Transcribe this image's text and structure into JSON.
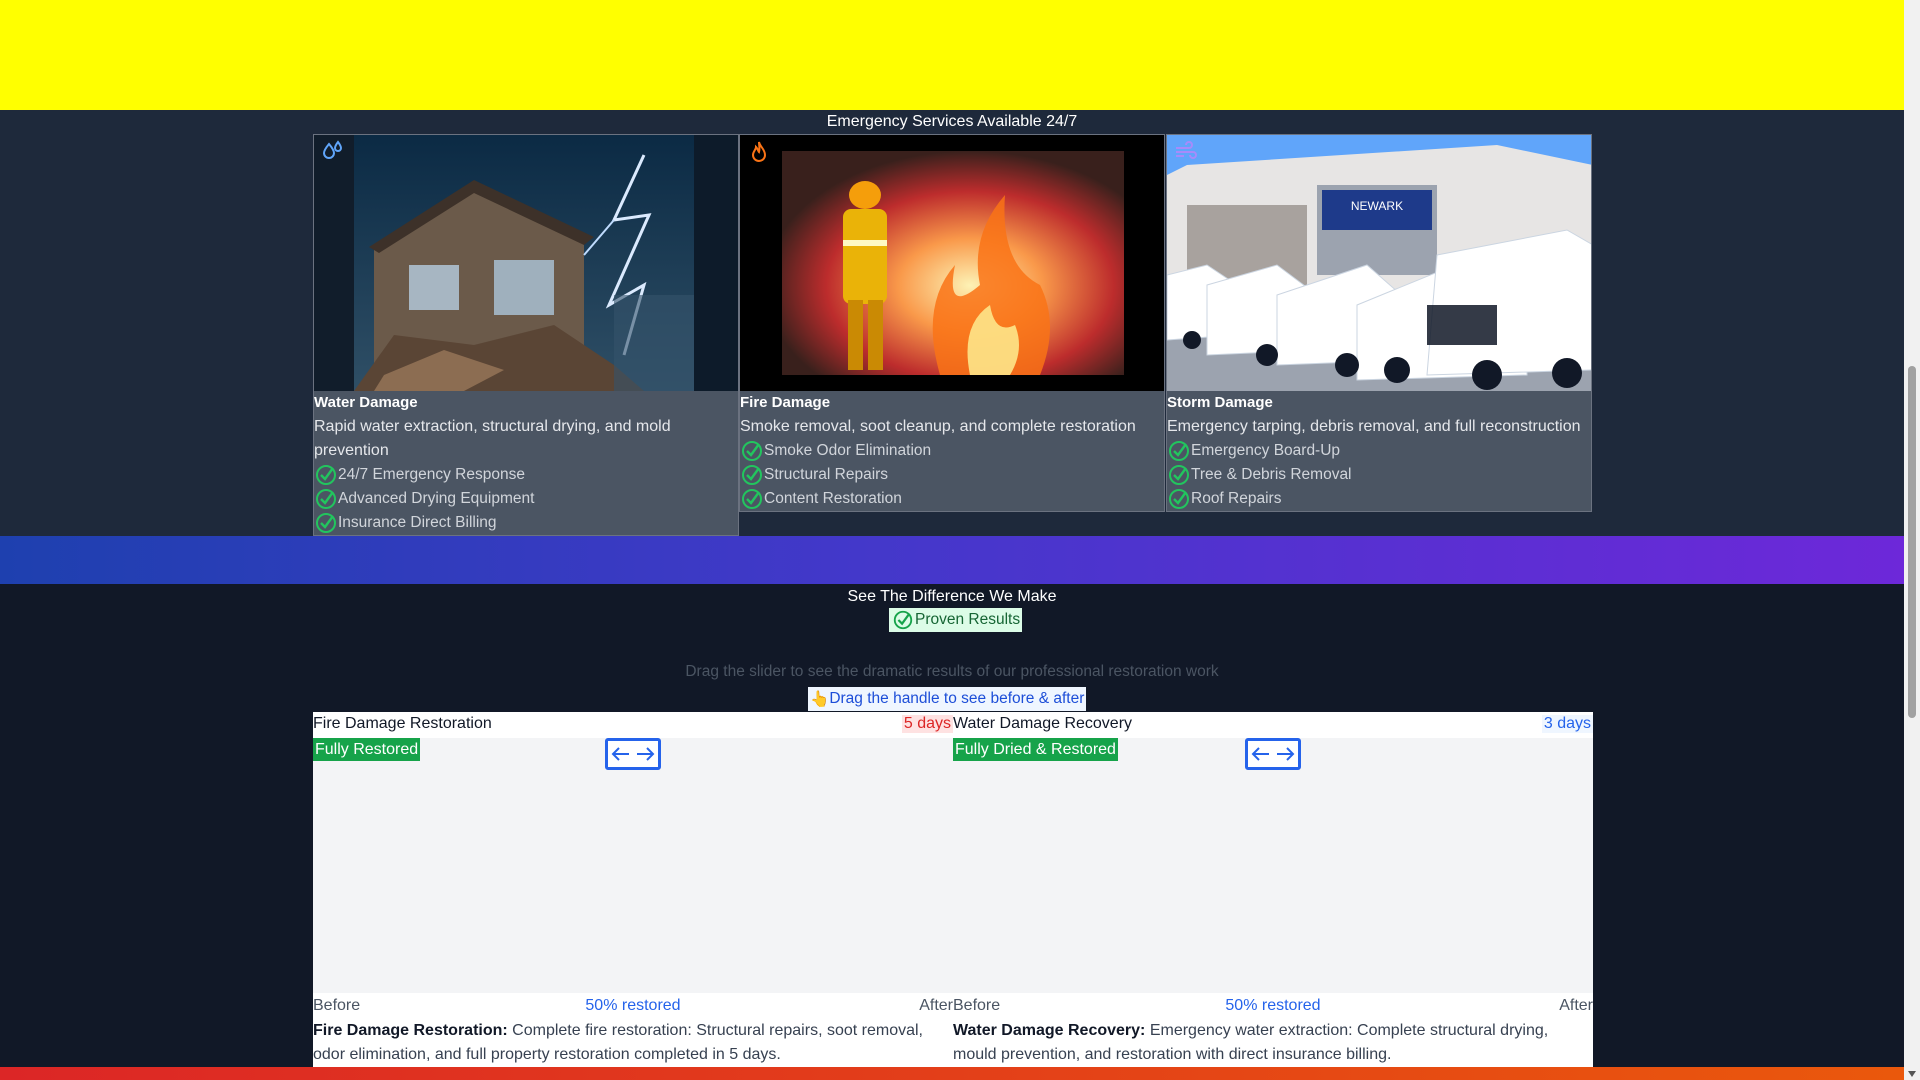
{
  "services": {
    "heading": "Emergency Services Available 24/7",
    "cards": [
      {
        "icon": "water-drops-icon",
        "title": "Water Damage",
        "description": "Rapid water extraction, structural drying, and mold prevention",
        "features": [
          "24/7 Emergency Response",
          "Advanced Drying Equipment",
          "Insurance Direct Billing"
        ]
      },
      {
        "icon": "flame-icon",
        "title": "Fire Damage",
        "description": "Smoke removal, soot cleanup, and complete restoration",
        "features": [
          "Smoke Odor Elimination",
          "Structural Repairs",
          "Content Restoration"
        ]
      },
      {
        "icon": "wind-icon",
        "title": "Storm Damage",
        "description": "Emergency tarping, debris removal, and full reconstruction",
        "features": [
          "Emergency Board-Up",
          "Tree & Debris Removal",
          "Roof Repairs"
        ],
        "sign_text": "NEWARK"
      }
    ]
  },
  "results": {
    "heading": "See The Difference We Make",
    "badge": "Proven Results",
    "subtitle": "Drag the slider to see the dramatic results of our professional restoration work",
    "hint_emoji": "👆",
    "hint": "Drag the handle to see before & after",
    "sliders": [
      {
        "title": "Fire Damage Restoration",
        "days": "5 days",
        "status": "Fully Restored",
        "before_label": "Before",
        "after_label": "After",
        "progress_label": "50% restored",
        "progress": 0.5,
        "desc_title": "Fire Damage Restoration:",
        "desc": " Complete fire restoration: Structural repairs, soot removal, odor elimination, and full property restoration completed in 5 days."
      },
      {
        "title": "Water Damage Recovery",
        "days": "3 days",
        "status": "Fully Dried & Restored",
        "before_label": "Before",
        "after_label": "After",
        "progress_label": "50% restored",
        "progress": 0.5,
        "desc_title": "Water Damage Recovery:",
        "desc": " Emergency water extraction: Complete structural drying, mould prevention, and restoration with direct insurance billing."
      }
    ]
  },
  "colors": {
    "top_band": "#ffff00",
    "check_green": "#22c55e",
    "accent_blue": "#2563eb",
    "status_green": "#16a34a"
  }
}
